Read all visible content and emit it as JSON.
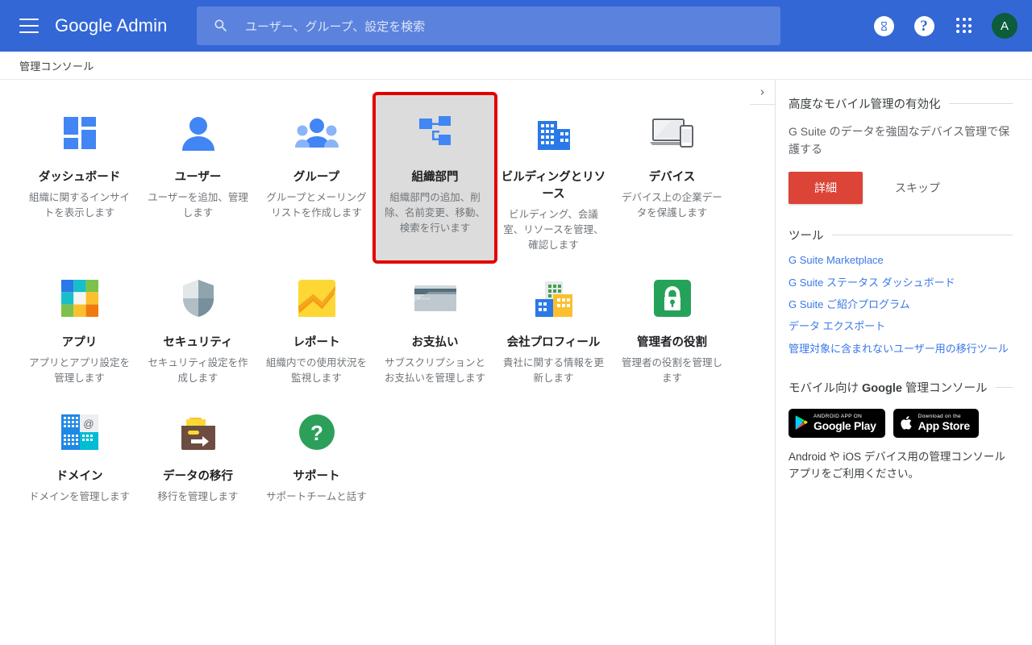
{
  "header": {
    "menu_icon": "hamburger-icon",
    "brand_google": "Google",
    "brand_admin": "Admin",
    "search_placeholder": "ユーザー、グループ、設定を検索",
    "search_icon": "search-icon",
    "trial_icon": "hourglass-icon",
    "help_icon": "help-icon",
    "help_glyph": "?",
    "apps_icon": "apps-grid-icon",
    "avatar_initial": "A",
    "bg_color": "#3367d6",
    "search_bg_color": "#5b82dd",
    "avatar_color": "#0b5d3b"
  },
  "breadcrumb": {
    "label": "管理コンソール"
  },
  "cards": [
    {
      "title": "ダッシュボード",
      "desc": "組織に関するインサイトを表示します",
      "icon": "dashboard-icon",
      "selected": false
    },
    {
      "title": "ユーザー",
      "desc": "ユーザーを追加、管理します",
      "icon": "user-icon",
      "selected": false
    },
    {
      "title": "グループ",
      "desc": "グループとメーリングリストを作成します",
      "icon": "groups-icon",
      "selected": false
    },
    {
      "title": "組織部門",
      "desc": "組織部門の追加、削除、名前変更、移動、検索を行います",
      "icon": "org-units-icon",
      "selected": true
    },
    {
      "title": "ビルディングとリソース",
      "desc": "ビルディング、会議室、リソースを管理、確認します",
      "icon": "buildings-icon",
      "selected": false
    },
    {
      "title": "デバイス",
      "desc": "デバイス上の企業データを保護します",
      "icon": "devices-icon",
      "selected": false
    },
    {
      "title": "アプリ",
      "desc": "アプリとアプリ設定を管理します",
      "icon": "apps-icon",
      "selected": false
    },
    {
      "title": "セキュリティ",
      "desc": "セキュリティ設定を作成します",
      "icon": "security-shield-icon",
      "selected": false
    },
    {
      "title": "レポート",
      "desc": "組織内での使用状況を監視します",
      "icon": "reports-chart-icon",
      "selected": false
    },
    {
      "title": "お支払い",
      "desc": "サブスクリプションとお支払いを管理します",
      "icon": "billing-card-icon",
      "selected": false
    },
    {
      "title": "会社プロフィール",
      "desc": "貴社に関する情報を更新します",
      "icon": "company-profile-icon",
      "selected": false
    },
    {
      "title": "管理者の役割",
      "desc": "管理者の役割を管理します",
      "icon": "admin-roles-lock-icon",
      "selected": false
    },
    {
      "title": "ドメイン",
      "desc": "ドメインを管理します",
      "icon": "domains-icon",
      "selected": false
    },
    {
      "title": "データの移行",
      "desc": "移行を管理します",
      "icon": "data-migration-icon",
      "selected": false
    },
    {
      "title": "サポート",
      "desc": "サポートチームと話す",
      "icon": "support-question-icon",
      "selected": false
    }
  ],
  "right_panel": {
    "collapse_icon": "chevron-right-icon",
    "promo": {
      "heading": "高度なモバイル管理の有効化",
      "body": "G Suite のデータを強固なデバイス管理で保護する",
      "primary_label": "詳細",
      "secondary_label": "スキップ",
      "primary_color": "#db4437"
    },
    "tools": {
      "heading": "ツール",
      "links": [
        "G Suite Marketplace",
        "G Suite ステータス ダッシュボード",
        "G Suite ご紹介プログラム",
        "データ エクスポート",
        "管理対象に含まれないユーザー用の移行ツール"
      ],
      "link_color": "#3b78e7"
    },
    "mobile": {
      "heading_pre": "モバイル向け ",
      "heading_bold": "Google",
      "heading_post": " 管理コンソール",
      "google_play": {
        "small": "ANDROID APP ON",
        "large": "Google Play",
        "icon": "google-play-icon"
      },
      "app_store": {
        "small": "Download on the",
        "large": "App Store",
        "icon": "apple-icon"
      },
      "note": "Android や iOS デバイス用の管理コンソール アプリをご利用ください。"
    }
  }
}
